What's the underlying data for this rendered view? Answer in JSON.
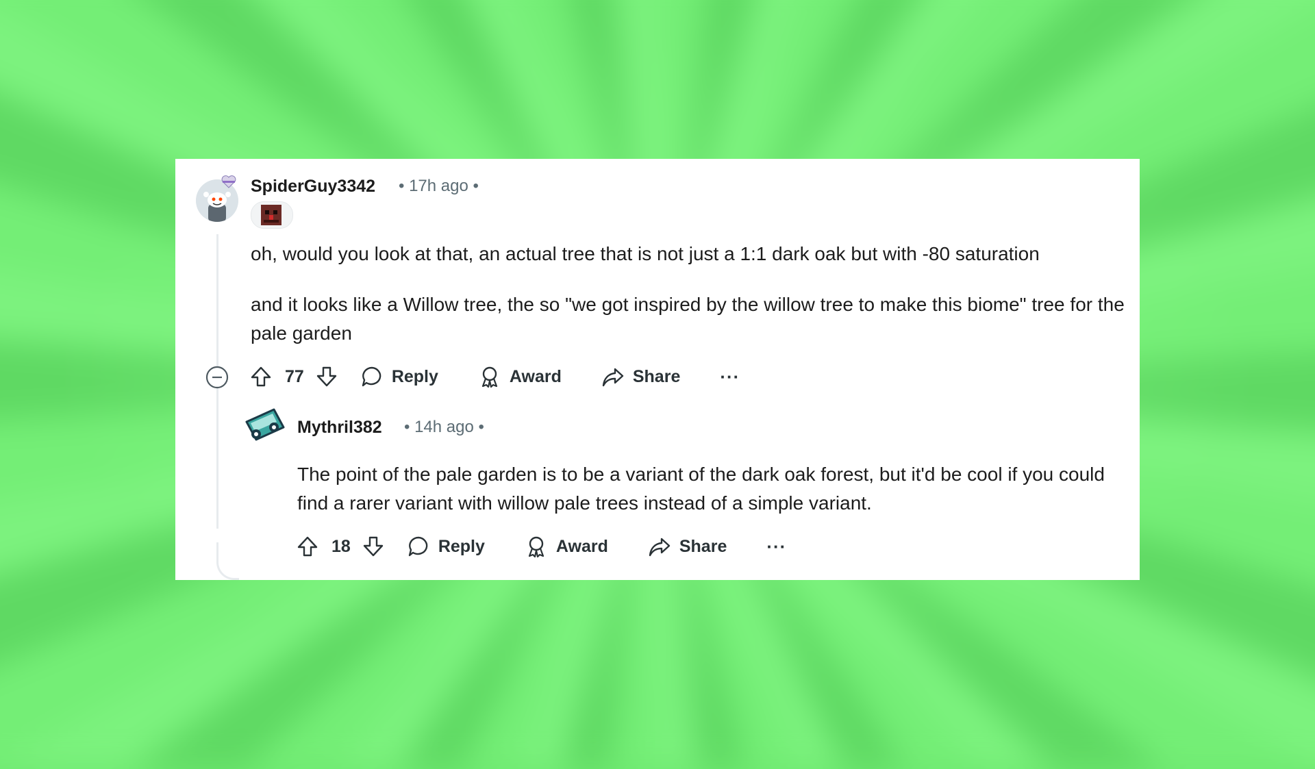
{
  "comments": [
    {
      "username": "SpiderGuy3342",
      "time": "• 17h ago •",
      "paragraphs": [
        "oh, would you look at that, an actual tree that is not just a 1:1 dark oak but with -80 saturation",
        "and it looks like a Willow tree, the so \"we got inspired by the willow tree to make this biome\" tree for the pale garden"
      ],
      "votes": "77",
      "actions": {
        "reply": "Reply",
        "award": "Award",
        "share": "Share",
        "more": "···"
      }
    },
    {
      "username": "Mythril382",
      "time": "• 14h ago •",
      "paragraphs": [
        "The point of the pale garden is to be a variant of the dark oak forest, but it'd be cool if you could find a rarer variant with willow pale trees instead of a simple variant."
      ],
      "votes": "18",
      "actions": {
        "reply": "Reply",
        "award": "Award",
        "share": "Share",
        "more": "···"
      }
    }
  ],
  "icons": {
    "upvote": "arrow-up-outline-icon",
    "downvote": "arrow-down-outline-icon",
    "reply": "speech-bubble-icon",
    "award": "award-ribbon-icon",
    "share": "share-arrow-icon",
    "collapse": "minus-circle-icon"
  },
  "colors": {
    "background": "#6ee870",
    "card": "#ffffff",
    "text": "#1c1c1c",
    "meta": "#5c6c74"
  }
}
